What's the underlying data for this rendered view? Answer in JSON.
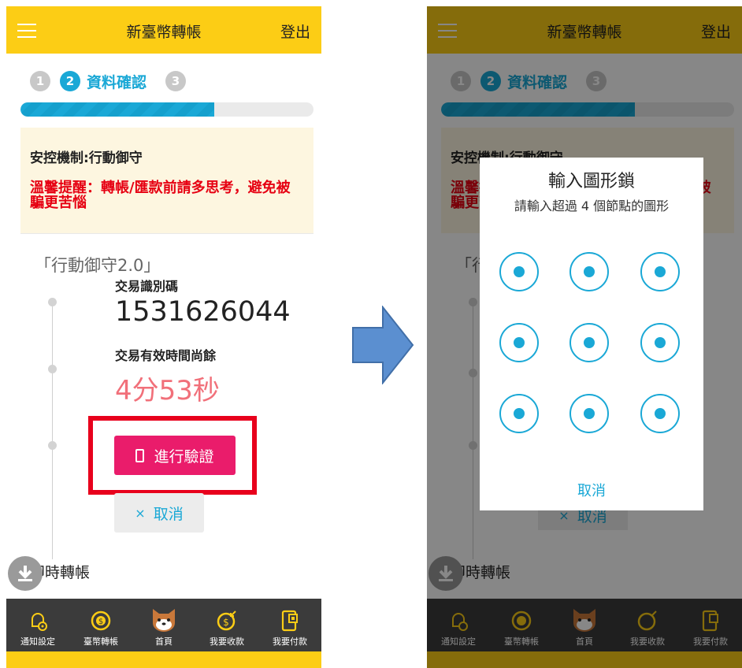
{
  "header": {
    "menu_icon": "hamburger-icon",
    "title": "新臺幣轉帳",
    "logout_label": "登出"
  },
  "steps": [
    {
      "num": "1",
      "label": "",
      "active": false
    },
    {
      "num": "2",
      "label": "資料確認",
      "active": true
    },
    {
      "num": "3",
      "label": "",
      "active": false
    }
  ],
  "progress_fraction": 0.66,
  "notice": {
    "mechanism": "安控機制:行動御守",
    "warning": "溫馨提醒：轉帳/匯款前請多思考，避免被騙更苦惱"
  },
  "brand": "「行動御守2.0」",
  "transaction": {
    "id_label": "交易識別碼",
    "id_value": "1531626044",
    "time_label": "交易有效時間尚餘",
    "time_value": "4分53秒"
  },
  "actions": {
    "verify_label": "進行驗證",
    "cancel_label": "取消",
    "cancel_prefix": "×"
  },
  "instant_transfer": "即時轉帳",
  "bottom_nav": [
    {
      "label": "通知設定",
      "icon": "bell-gear-icon"
    },
    {
      "label": "臺幣轉帳",
      "icon": "coin-transfer-icon"
    },
    {
      "label": "首頁",
      "icon": "shiba-home-icon"
    },
    {
      "label": "我要收款",
      "icon": "receive-money-icon"
    },
    {
      "label": "我要付款",
      "icon": "pay-qr-icon"
    }
  ],
  "pattern_dialog": {
    "title": "輸入圖形鎖",
    "subtitle": "請輸入超過 4 個節點的圖形",
    "cancel_label": "取消",
    "node_count": 9
  },
  "colors": {
    "brand_yellow": "#fccd15",
    "accent_blue": "#1aa8d6",
    "verify_pink": "#ea1c6b",
    "highlight_red": "#e8001c",
    "arrow_blue": "#5b8fd0"
  }
}
